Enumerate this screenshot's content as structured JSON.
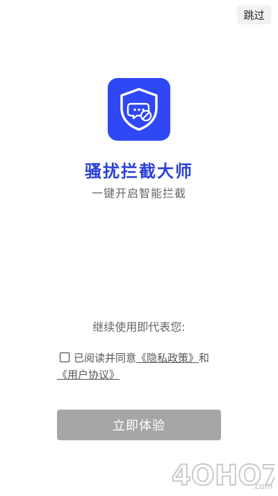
{
  "header": {
    "skip_label": "跳过"
  },
  "app": {
    "name": "骚扰拦截大师",
    "slogan": "一键开启智能拦截",
    "logo_icon": "shield-message-block-icon",
    "brand_color": "#2f47f5"
  },
  "consent": {
    "continue_text": "继续使用即代表您:",
    "agree_prefix": "已阅读并同意",
    "privacy_link": "《隐私政策》",
    "and_text": "和",
    "terms_link": "《用户协议》",
    "checked": false
  },
  "cta": {
    "label": "立即体验",
    "color": "#a6a6a6"
  },
  "watermark": {
    "text": "4OHO7.com"
  }
}
